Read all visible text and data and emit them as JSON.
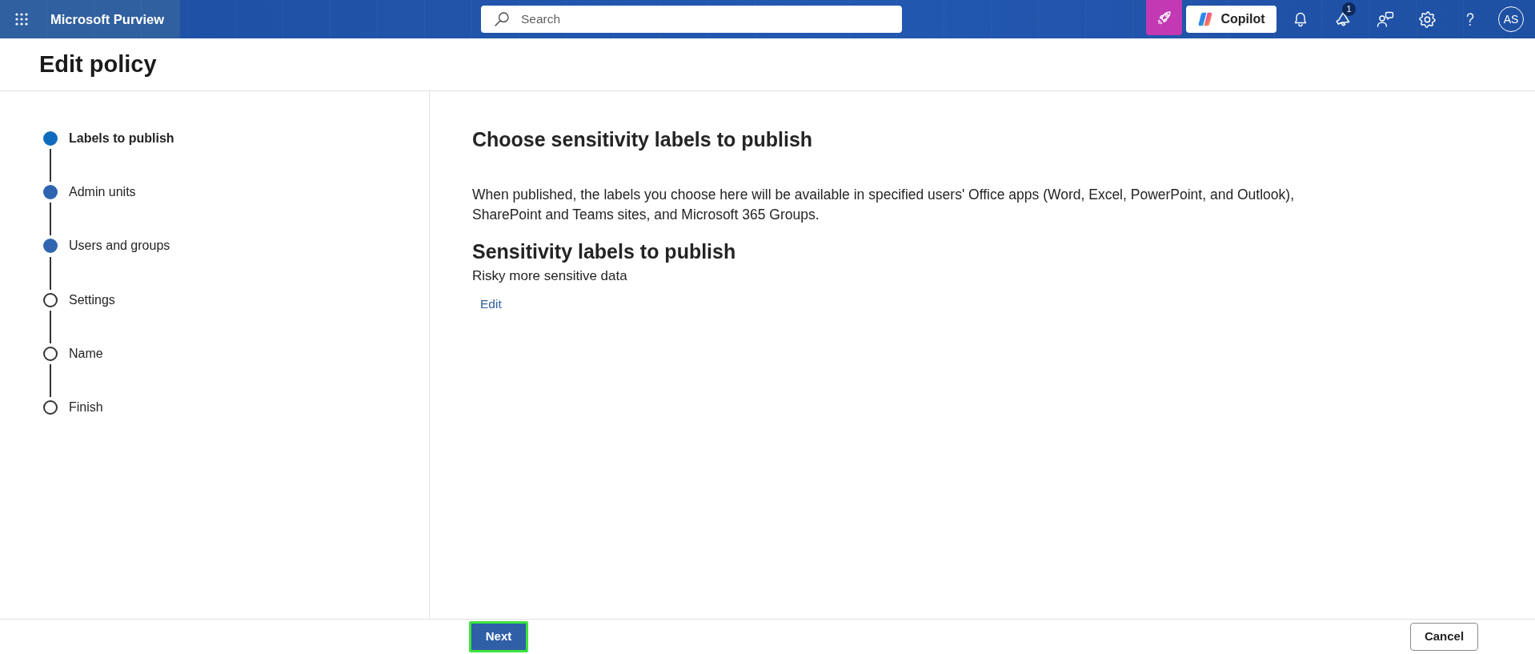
{
  "top_bar": {
    "app_name": "Microsoft Purview",
    "search": {
      "placeholder": "Search"
    },
    "copilot_button": "Copilot",
    "notification_count": "1",
    "avatar_initials": "AS"
  },
  "page": {
    "title": "Edit policy"
  },
  "steps": [
    {
      "label": "Labels to publish",
      "selected": true,
      "completed": false
    },
    {
      "label": "Admin units",
      "selected": false,
      "completed": true
    },
    {
      "label": "Users and groups",
      "selected": false,
      "completed": true
    },
    {
      "label": "Settings",
      "selected": false,
      "completed": false
    },
    {
      "label": "Name",
      "selected": false,
      "completed": false
    },
    {
      "label": "Finish",
      "selected": false,
      "completed": false
    }
  ],
  "content": {
    "heading": "Choose sensitivity labels to publish",
    "description": "When published, the labels you choose here will be available in specified users' Office apps (Word, Excel, PowerPoint, and Outlook), SharePoint and Teams sites, and Microsoft 365 Groups.",
    "section_heading": "Sensitivity labels to publish",
    "section_value": "Risky more sensitive data",
    "edit_link": "Edit"
  },
  "footer": {
    "buttons": [
      {
        "label": "Next",
        "kind": "primary",
        "highlighted": true
      },
      {
        "label": "Cancel",
        "kind": "secondary",
        "highlighted": false
      }
    ]
  }
}
